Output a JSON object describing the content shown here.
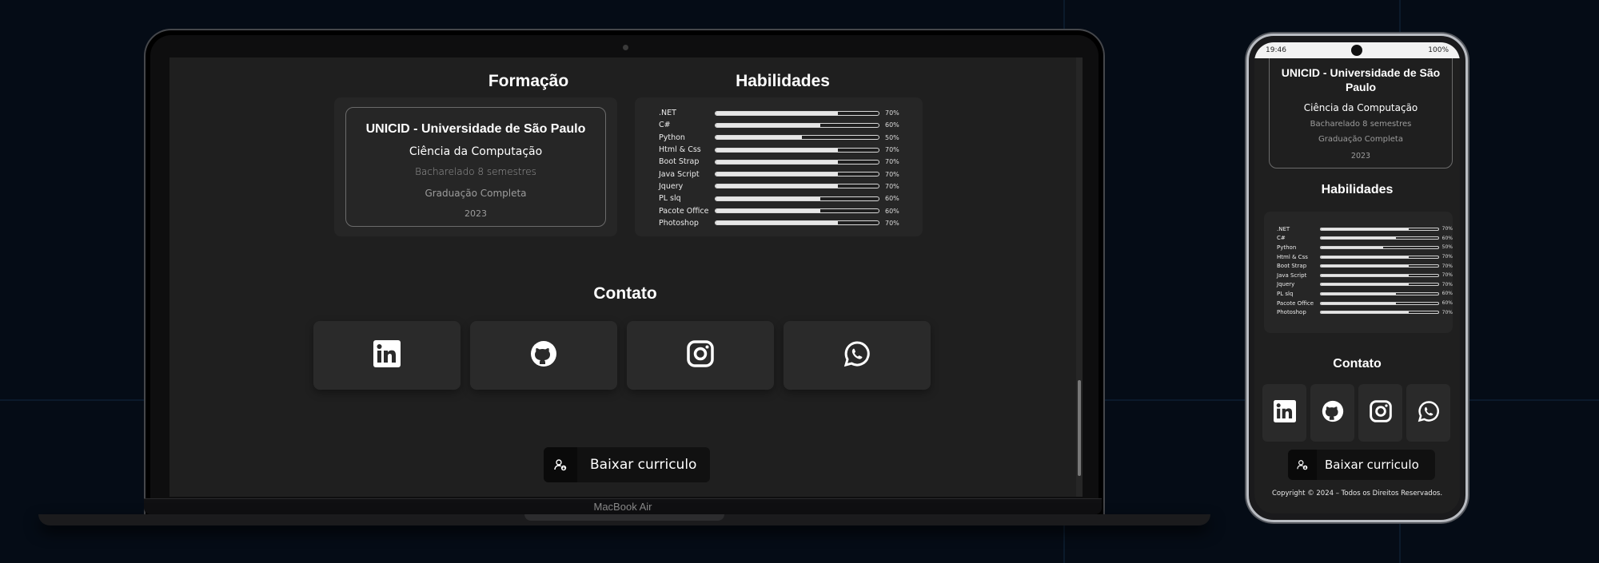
{
  "laptop": {
    "brand": "MacBook Air"
  },
  "formacao": {
    "title": "Formação",
    "university": "UNICID - Universidade de São Paulo",
    "course": "Ciência da Computação",
    "detail": "Bacharelado 8 semestres",
    "status": "Graduação Completa",
    "year": "2023"
  },
  "habilidades": {
    "title": "Habilidades",
    "skills": [
      {
        "name": ".NET",
        "pct": "70%",
        "level": 0.75
      },
      {
        "name": "C#",
        "pct": "60%",
        "level": 0.64
      },
      {
        "name": "Python",
        "pct": "50%",
        "level": 0.53
      },
      {
        "name": "Html & Css",
        "pct": "70%",
        "level": 0.75
      },
      {
        "name": "Boot Strap",
        "pct": "70%",
        "level": 0.75
      },
      {
        "name": "Java Script",
        "pct": "70%",
        "level": 0.75
      },
      {
        "name": "Jquery",
        "pct": "70%",
        "level": 0.75
      },
      {
        "name": "PL slq",
        "pct": "60%",
        "level": 0.64
      },
      {
        "name": "Pacote Office",
        "pct": "60%",
        "level": 0.64
      },
      {
        "name": "Photoshop",
        "pct": "70%",
        "level": 0.75
      }
    ]
  },
  "contato": {
    "title": "Contato",
    "items": [
      {
        "icon": "linkedin-icon"
      },
      {
        "icon": "github-icon"
      },
      {
        "icon": "instagram-icon"
      },
      {
        "icon": "whatsapp-icon"
      }
    ]
  },
  "download": {
    "label": "Baixar curriculo",
    "icon": "user-download-icon"
  },
  "phone": {
    "time": "19:46",
    "battery": "100%",
    "footer": "Copyright © 2024 – Todos os Direitos Reservados."
  },
  "colors": {
    "background": "#050c16",
    "panel": "#1f1f1f",
    "card": "#262626",
    "text": "#ffffff"
  }
}
